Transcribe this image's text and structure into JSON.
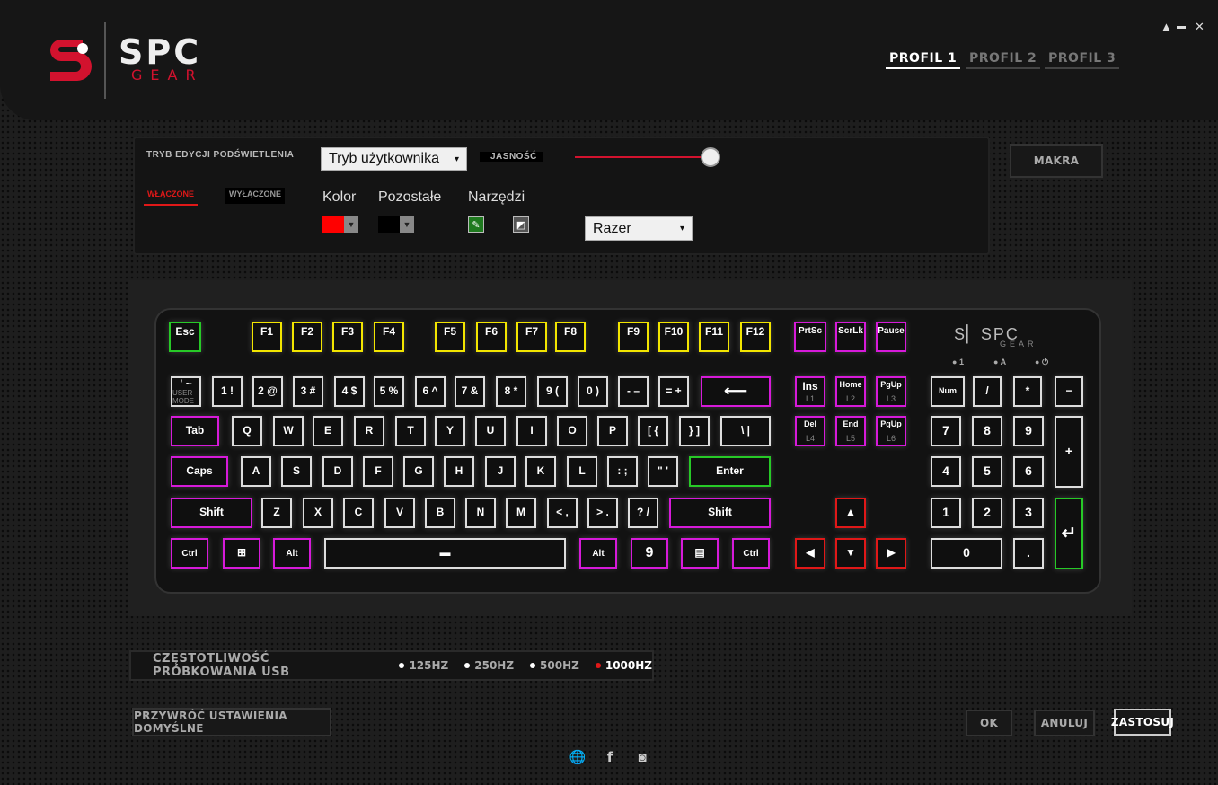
{
  "header": {
    "logo_text": "SPC",
    "logo_sub": "GEAR",
    "win_minimize": "▲",
    "win_line": "▬",
    "win_close": "✕",
    "profiles": [
      "PROFIL 1",
      "PROFIL 2",
      "PROFIL 3"
    ],
    "active_profile": 0
  },
  "lighting": {
    "mode_label": "TRYB EDYCJI PODŚWIETLENIA",
    "mode_value": "Tryb użytkownika",
    "brightness_label": "JASNOŚĆ",
    "brightness_percent": 100,
    "on_label": "WŁĄCZONE",
    "off_label": "WYŁĄCZONE",
    "color_label": "Kolor",
    "other_label": "Pozostałe",
    "tools_label": "Narzędzi",
    "color_value": "#ff0000",
    "other_value": "#000000",
    "preset_value": "Razer"
  },
  "buttons": {
    "macros": "MAKRA",
    "reset": "PRZYWRÓĆ USTAWIENIA DOMYŚLNE",
    "ok": "OK",
    "cancel": "ANULUJ",
    "apply": "ZASTOSUJ"
  },
  "usb": {
    "label": "CZĘSTOTLIWOŚĆ PRÓBKOWANIA USB",
    "options": [
      "125HZ",
      "250HZ",
      "500HZ",
      "1000HZ"
    ],
    "selected": 3
  },
  "keyboard": {
    "logo": "SPC",
    "logo_sub": "GEAR",
    "leds": [
      "1",
      "A",
      "⏻"
    ],
    "keys": {
      "esc": "Esc",
      "f1": "F1",
      "f2": "F2",
      "f3": "F3",
      "f4": "F4",
      "f5": "F5",
      "f6": "F6",
      "f7": "F7",
      "f8": "F8",
      "f9": "F9",
      "f10": "F10",
      "f11": "F11",
      "f12": "F12",
      "prtsc": "PrtSc",
      "scrlk": "ScrLk",
      "pause": "Pause",
      "tilde": "' ~",
      "tilde_sub": "USER MODE",
      "n1": "1 !",
      "n2": "2 @",
      "n3": "3 #",
      "n4": "4 $",
      "n5": "5 %",
      "n6": "6 ^",
      "n7": "7 &",
      "n8": "8 *",
      "n9": "9 (",
      "n0": "0 )",
      "minus": "- –",
      "equal": "= +",
      "backspace": "⟵",
      "ins": "Ins",
      "ins_sub": "L1",
      "home": "Home",
      "home_sub": "L2",
      "pgup": "PgUp",
      "pgup_sub": "L3",
      "del": "Del",
      "del_sub": "L4",
      "end": "End",
      "end_sub": "L5",
      "pgdn": "PgUp",
      "pgdn_sub": "L6",
      "num": "Num",
      "div": "/",
      "mul": "*",
      "sub": "−",
      "tab": "Tab",
      "q": "Q",
      "w": "W",
      "e": "E",
      "r": "R",
      "t": "T",
      "y": "Y",
      "u": "U",
      "i": "I",
      "o": "O",
      "p": "P",
      "lbr": "[ {",
      "rbr": "} ]",
      "bslash": "\\ |",
      "caps": "Caps",
      "a": "A",
      "s": "S",
      "d": "D",
      "f": "F",
      "g": "G",
      "h": "H",
      "j": "J",
      "k": "K",
      "l": "L",
      "semi": ": ;",
      "quote": "\" '",
      "enter": "Enter",
      "lshift": "Shift",
      "z": "Z",
      "x": "X",
      "c": "C",
      "v": "V",
      "b": "B",
      "n": "N",
      "m": "M",
      "comma": "< ,",
      "period": "> .",
      "slash": "? /",
      "rshift": "Shift",
      "lctrl": "Ctrl",
      "win": "⊞",
      "lalt": "Alt",
      "space": "▬",
      "ralt": "Alt",
      "fn": "9",
      "menu": "▤",
      "rctrl": "Ctrl",
      "up": "▲",
      "left": "◀",
      "down": "▼",
      "right": "▶",
      "k7": "7",
      "k8": "8",
      "k9": "9",
      "add": "+",
      "k4": "4",
      "k5": "5",
      "k6": "6",
      "k1": "1",
      "k2": "2",
      "k3": "3",
      "kenter": "↵",
      "k0": "0",
      "kdot": "."
    }
  },
  "social": {
    "web": "🌐",
    "facebook": "f",
    "instagram": "◙"
  }
}
